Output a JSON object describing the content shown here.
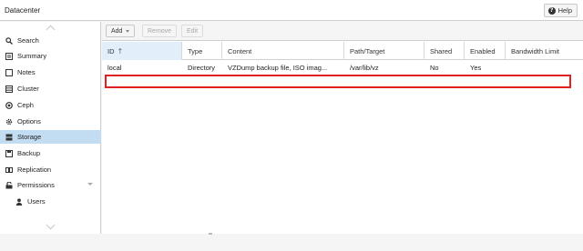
{
  "app": {
    "title": "Datacenter",
    "help_label": "Help"
  },
  "sidebar": {
    "items": [
      {
        "label": "Search",
        "icon": "search-icon"
      },
      {
        "label": "Summary",
        "icon": "summary-icon"
      },
      {
        "label": "Notes",
        "icon": "notes-icon"
      },
      {
        "label": "Cluster",
        "icon": "cluster-icon"
      },
      {
        "label": "Ceph",
        "icon": "ceph-icon"
      },
      {
        "label": "Options",
        "icon": "gear-icon"
      },
      {
        "label": "Storage",
        "icon": "storage-icon",
        "selected": true
      },
      {
        "label": "Backup",
        "icon": "backup-icon"
      },
      {
        "label": "Replication",
        "icon": "replication-icon"
      },
      {
        "label": "Permissions",
        "icon": "lock-icon",
        "expandable": true
      },
      {
        "label": "Users",
        "icon": "user-icon",
        "sub": true
      }
    ]
  },
  "toolbar": {
    "add_label": "Add",
    "remove_label": "Remove",
    "edit_label": "Edit"
  },
  "grid": {
    "columns": [
      "ID",
      "Type",
      "Content",
      "Path/Target",
      "Shared",
      "Enabled",
      "Bandwidth Limit"
    ],
    "sorted_column": "ID",
    "rows": [
      {
        "id": "local",
        "type": "Directory",
        "content": "VZDump backup file, ISO imag...",
        "path": "/var/lib/vz",
        "shared": "No",
        "enabled": "Yes",
        "bandwidth": ""
      }
    ]
  },
  "colors": {
    "selected_bg": "#c2ddf2",
    "highlight": "#e02020",
    "accent": "#3892d4"
  }
}
